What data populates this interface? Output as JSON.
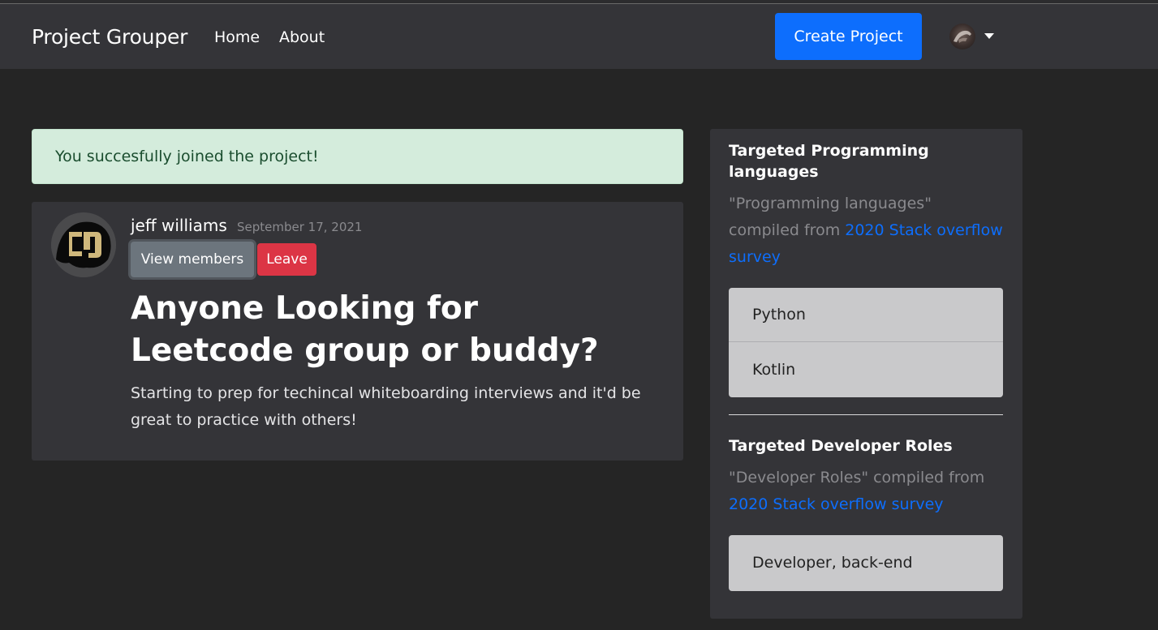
{
  "navbar": {
    "brand": "Project Grouper",
    "links": [
      "Home",
      "About"
    ],
    "create_button": "Create Project"
  },
  "alert": {
    "message": "You succesfully joined the project!"
  },
  "post": {
    "author": "jeff williams",
    "date": "September 17, 2021",
    "view_members_label": "View members",
    "leave_label": "Leave",
    "title": "Anyone Looking for Leetcode group or buddy?",
    "body": "Starting to prep for techincal whiteboarding interviews and it'd be great to practice with others!"
  },
  "sidebar": {
    "languages": {
      "heading": "Targeted Programming languages",
      "desc_prefix": "\"Programming languages\" compiled from ",
      "link": "2020 Stack overflow survey",
      "items": [
        "Python",
        "Kotlin"
      ]
    },
    "roles": {
      "heading": "Targeted Developer Roles",
      "desc_prefix": "\"Developer Roles\" compiled from ",
      "link": "2020 Stack overflow survey",
      "items": [
        "Developer, back-end"
      ]
    }
  },
  "colors": {
    "primary": "#0d6efd",
    "danger": "#dc3545",
    "secondary": "#6c757d",
    "success_bg": "#d4ecdc"
  }
}
